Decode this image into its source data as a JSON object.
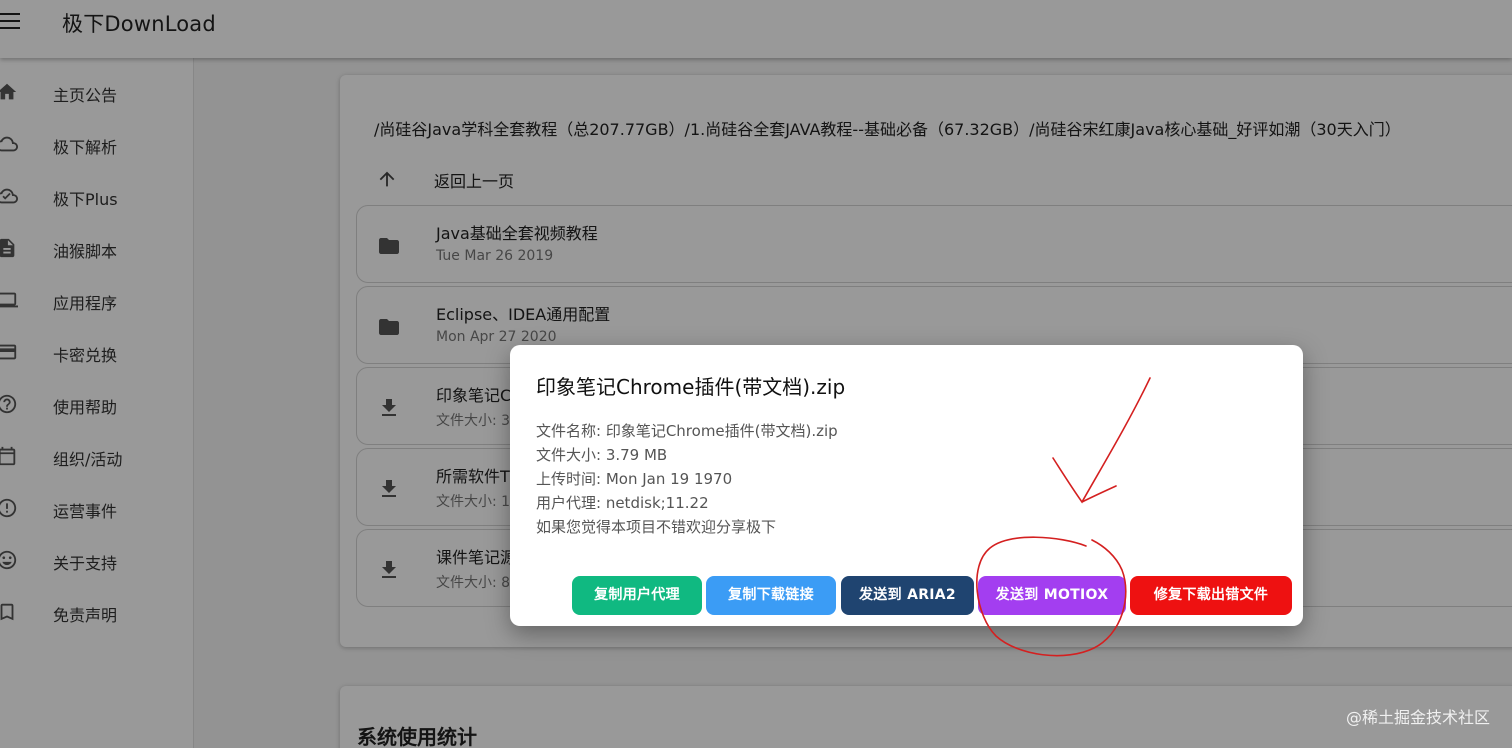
{
  "app": {
    "title": "极下DownLoad"
  },
  "sidebar": {
    "items": [
      {
        "label": "主页公告",
        "icon": "home-icon"
      },
      {
        "label": "极下解析",
        "icon": "cloud-icon"
      },
      {
        "label": "极下Plus",
        "icon": "cloud-plus-icon"
      },
      {
        "label": "油猴脚本",
        "icon": "document-icon"
      },
      {
        "label": "应用程序",
        "icon": "laptop-icon"
      },
      {
        "label": "卡密兑换",
        "icon": "credit-card-icon"
      },
      {
        "label": "使用帮助",
        "icon": "help-icon"
      },
      {
        "label": "组织/活动",
        "icon": "event-icon"
      },
      {
        "label": "运营事件",
        "icon": "alert-icon"
      },
      {
        "label": "关于支持",
        "icon": "smile-icon"
      },
      {
        "label": "免责声明",
        "icon": "bookmark-icon"
      }
    ]
  },
  "main": {
    "path": "/尚硅谷Java学科全套教程（总207.77GB）/1.尚硅谷全套JAVA教程--基础必备（67.32GB）/尚硅谷宋红康Java核心基础_好评如潮（30天入门）",
    "back_label": "返回上一页",
    "files": [
      {
        "name": "Java基础全套视频教程",
        "sub": "Tue Mar 26 2019",
        "type": "folder"
      },
      {
        "name": "Eclipse、IDEA通用配置",
        "sub": "Mon Apr 27 2020",
        "type": "folder"
      },
      {
        "name": "印象笔记C",
        "sub": "文件大小: 3",
        "type": "file"
      },
      {
        "name": "所需软件T",
        "sub": "文件大小: 1",
        "type": "file"
      },
      {
        "name": "课件笔记源",
        "sub": "文件大小: 8",
        "type": "file"
      }
    ],
    "stats_title": "系统使用统计"
  },
  "dialog": {
    "title": "印象笔记Chrome插件(带文档).zip",
    "lines": [
      "文件名称: 印象笔记Chrome插件(带文档).zip",
      "文件大小: 3.79 MB",
      "上传时间: Mon Jan 19 1970",
      "用户代理: netdisk;11.22",
      "如果您觉得本项目不错欢迎分享极下"
    ],
    "buttons": [
      {
        "label": "复制用户代理",
        "color": "#10b981"
      },
      {
        "label": "复制下载链接",
        "color": "#3b9cf5"
      },
      {
        "label": "发送到 ARIA2",
        "color": "#1f4470"
      },
      {
        "label": "发送到 MOTIOX",
        "color": "#a33ef0"
      },
      {
        "label": "修复下载出错文件",
        "color": "#ee1111"
      }
    ]
  },
  "watermark": "@稀土掘金技术社区",
  "colors": {
    "overlay": "rgba(0,0,0,0.40)",
    "annotation": "#d42020"
  }
}
